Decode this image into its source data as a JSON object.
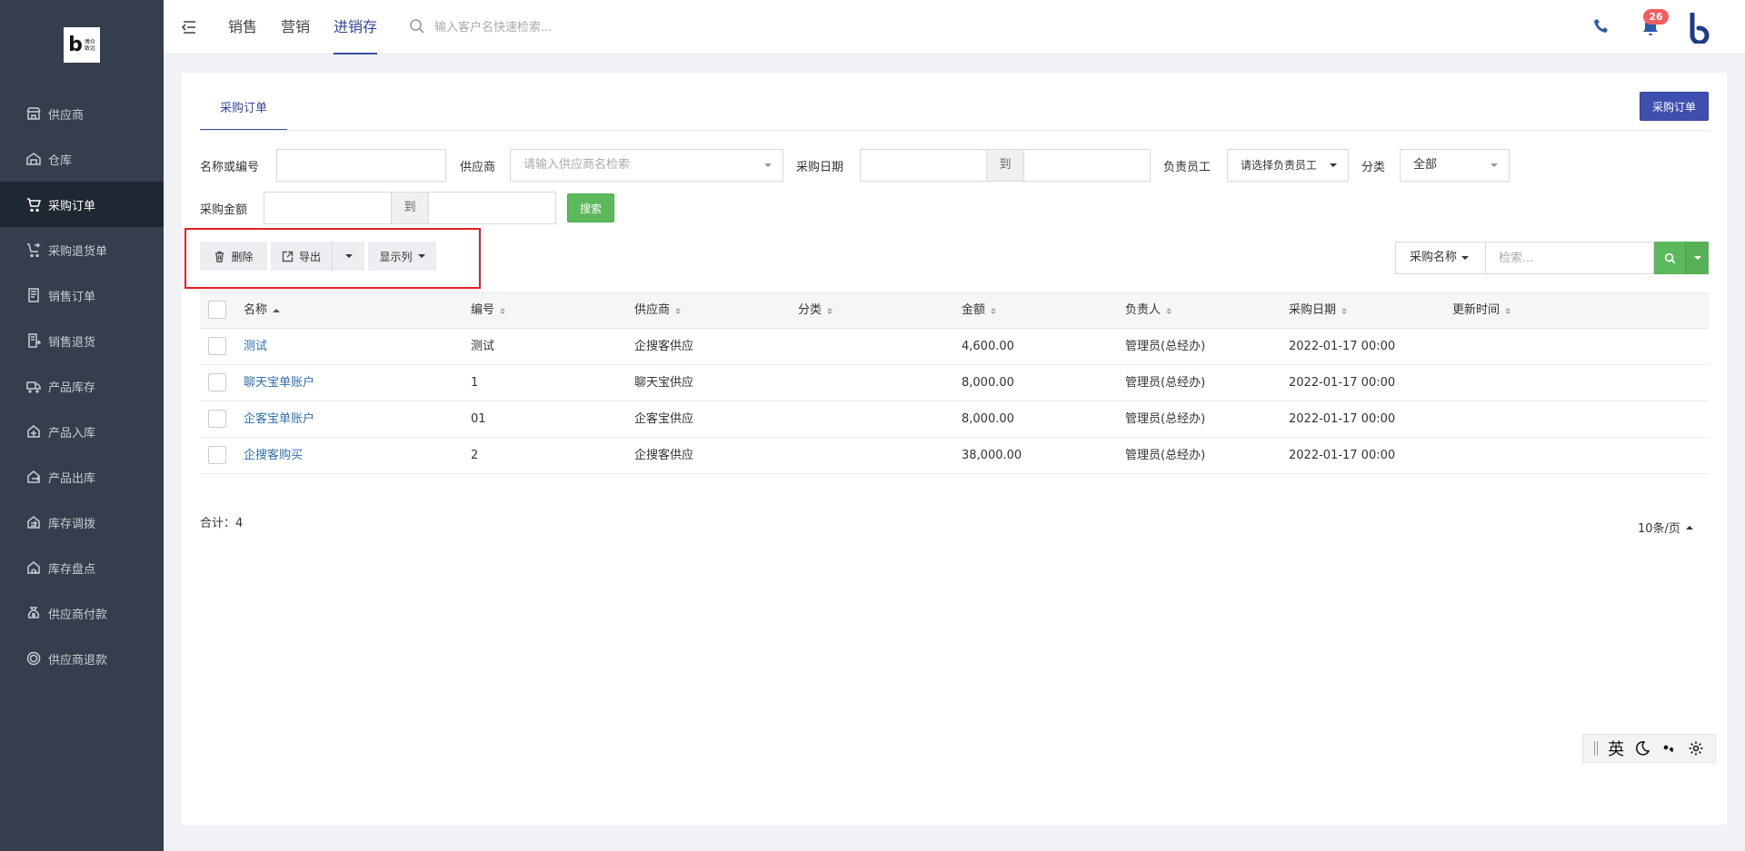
{
  "brand": {
    "logo_letter": "b",
    "logo_text": "博众\n致远"
  },
  "sidebar": {
    "items": [
      {
        "label": "供应商",
        "icon": "store-icon"
      },
      {
        "label": "仓库",
        "icon": "warehouse-icon"
      },
      {
        "label": "采购订单",
        "icon": "cart-icon",
        "active": true
      },
      {
        "label": "采购退货单",
        "icon": "cart-return-icon"
      },
      {
        "label": "销售订单",
        "icon": "order-list-icon"
      },
      {
        "label": "销售退货",
        "icon": "sales-return-icon"
      },
      {
        "label": "产品库存",
        "icon": "truck-icon"
      },
      {
        "label": "产品入库",
        "icon": "inbound-icon"
      },
      {
        "label": "产品出库",
        "icon": "outbound-icon"
      },
      {
        "label": "库存调拨",
        "icon": "transfer-icon"
      },
      {
        "label": "库存盘点",
        "icon": "inventory-check-icon"
      },
      {
        "label": "供应商付款",
        "icon": "money-bag-icon"
      },
      {
        "label": "供应商退款",
        "icon": "refund-icon"
      }
    ]
  },
  "topbar": {
    "nav": [
      {
        "label": "销售",
        "active": false
      },
      {
        "label": "营销",
        "active": false
      },
      {
        "label": "进销存",
        "active": true
      }
    ],
    "search_placeholder": "输入客户名快速检索...",
    "notification_count": "26"
  },
  "page": {
    "tab": "采购订单",
    "primary_button": "采购订单",
    "filters": {
      "name_label": "名称或编号",
      "name_value": "",
      "supplier_label": "供应商",
      "supplier_placeholder": "请输入供应商名检索",
      "date_label": "采购日期",
      "to_label": "到",
      "owner_label": "负责员工",
      "owner_placeholder": "请选择负责员工",
      "category_label": "分类",
      "category_value": "全部",
      "amount_label": "采购金额",
      "search_button": "搜索"
    },
    "toolbar": {
      "delete": "删除",
      "export": "导出",
      "columns": "显示列"
    },
    "quick_filter": {
      "field": "采购名称",
      "placeholder": "检索..."
    },
    "table": {
      "columns": [
        "名称",
        "编号",
        "供应商",
        "分类",
        "金额",
        "负责人",
        "采购日期",
        "更新时间"
      ],
      "rows": [
        {
          "name": "测试",
          "code": "测试",
          "supplier": "企搜客供应",
          "category": "",
          "amount": "4,600.00",
          "owner": "管理员(总经办)",
          "date": "2022-01-17 00:00",
          "updated": ""
        },
        {
          "name": "聊天宝单账户",
          "code": "1",
          "supplier": "聊天宝供应",
          "category": "",
          "amount": "8,000.00",
          "owner": "管理员(总经办)",
          "date": "2022-01-17 00:00",
          "updated": ""
        },
        {
          "name": "企客宝单账户",
          "code": "01",
          "supplier": "企客宝供应",
          "category": "",
          "amount": "8,000.00",
          "owner": "管理员(总经办)",
          "date": "2022-01-17 00:00",
          "updated": ""
        },
        {
          "name": "企搜客购买",
          "code": "2",
          "supplier": "企搜客供应",
          "category": "",
          "amount": "38,000.00",
          "owner": "管理员(总经办)",
          "date": "2022-01-17 00:00",
          "updated": ""
        }
      ]
    },
    "total_label": "合计：4",
    "page_size": "10条/页"
  },
  "ime": {
    "mode": "英"
  },
  "colors": {
    "sidebar_bg": "#343e4c",
    "sidebar_active": "#1f2733",
    "accent": "#3b4aa3",
    "success": "#5cb85c",
    "link": "#2f6fb0",
    "badge": "#f25d5d",
    "highlight_outline": "#e02020"
  }
}
